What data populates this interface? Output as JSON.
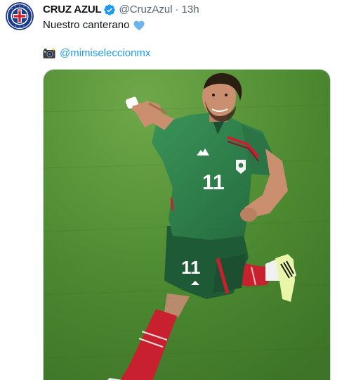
{
  "account": {
    "display_name": "CRUZ AZUL",
    "handle": "@CruzAzul",
    "separator": "·",
    "timestamp": "13h",
    "verified": true,
    "avatar_icon": "cruz-azul-crest-icon"
  },
  "tweet": {
    "text": "Nuestro canterano",
    "emoji": "blue-heart-icon",
    "credit_emoji": "camera-flash-icon",
    "credit_mention": "@mimiseleccionmx"
  },
  "media": {
    "type": "photo",
    "jersey_number": "11"
  },
  "colors": {
    "link": "#1d9bf0",
    "text": "#0f1419",
    "secondary": "#536471",
    "heart": "#6cb4ee",
    "verified": "#1d9bf0",
    "crest_blue": "#1a3a8f",
    "crest_red": "#d5202e",
    "pitch": "#4f8a32",
    "jersey": "#2f7d4a",
    "shorts": "#1f5a36",
    "socks": "#c8202e"
  }
}
